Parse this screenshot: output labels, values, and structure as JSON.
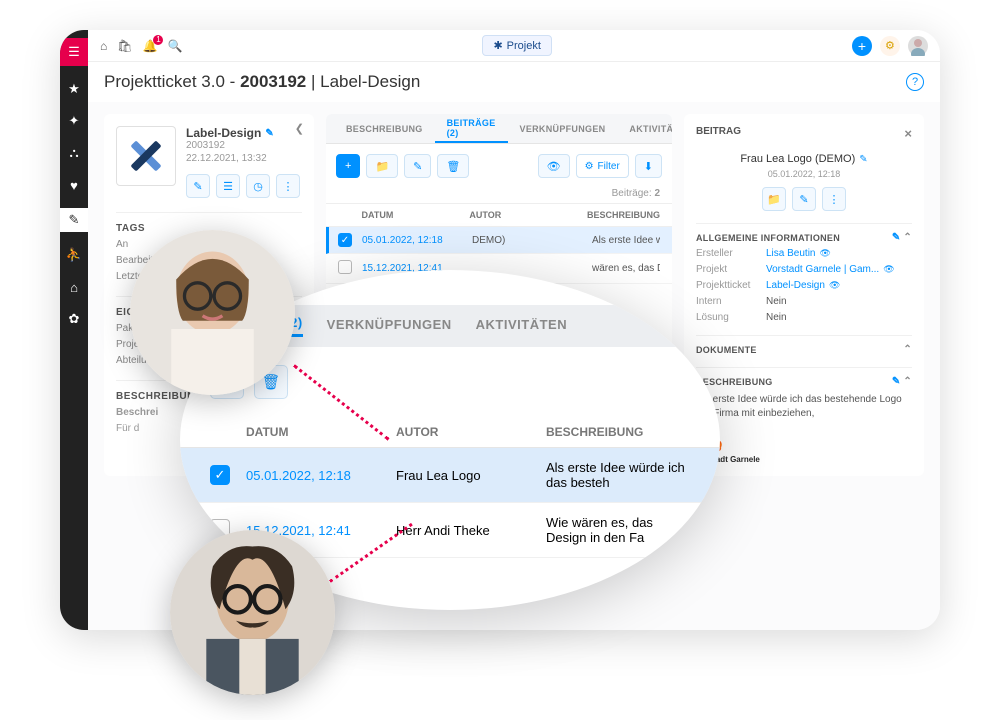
{
  "header": {
    "projectPill": "Projekt",
    "pageTitlePrefix": "Projektticket 3.0 - ",
    "pageTitleId": "2003192",
    "pageTitleName": " | Label-Design",
    "notificationCount": "1",
    "helpLabel": "?"
  },
  "leftPanel": {
    "title": "Label-Design",
    "id": "2003192",
    "date": "22.12.2021, 13:32",
    "sections": {
      "tags": "TAGS",
      "anbearbeitTruncated": "An",
      "bearbeit": "Bearbeit",
      "letzterBenh": "Letzter Benh",
      "eigenschaften": "EIGENSCHAFTEN",
      "paket": "Paket",
      "projektphase": "Projektphase",
      "abteilung": "Abteilung",
      "beschreibung": "BESCHREIBUNG",
      "beschreibTitle": "Beschrei",
      "beschreibBody": "Für d"
    }
  },
  "tabs": {
    "beschreibung": "BESCHREIBUNG",
    "beitraege": "BEITRÄGE (2)",
    "verknuepfungen": "VERKNÜPFUNGEN",
    "aktivitaeten": "AKTIVITÄTEN"
  },
  "midPanel": {
    "filterLabel": "Filter",
    "countLabel": "Beiträge: ",
    "countValue": "2",
    "columns": {
      "datum": "DATUM",
      "autor": "AUTOR",
      "beschreibung": "BESCHREIBUNG"
    },
    "rows": [
      {
        "selected": true,
        "date": "05.01.2022, 12:18",
        "authorTruncated": "DEMO)",
        "desc": "Als erste Idee würde ich das beste"
      },
      {
        "selected": false,
        "date": "15.12.2021, 12:41",
        "authorTruncated": "",
        "desc": "wären es, das Design in den I"
      }
    ]
  },
  "rightPanel": {
    "header": "BEITRAG",
    "title": "Frau Lea Logo (DEMO)",
    "date": "05.01.2022, 12:18",
    "sections": {
      "allgemeine": "ALLGEMEINE INFORMATIONEN",
      "dokumente": "DOKUMENTE",
      "beschreibung": "BESCHREIBUNG"
    },
    "info": {
      "erstellerLbl": "Ersteller",
      "erstellerVal": "Lisa Beutin",
      "projektLbl": "Projekt",
      "projektVal": "Vorstadt Garnele | Gam...",
      "ticketLbl": "Projektticket",
      "ticketVal": "Label-Design",
      "internLbl": "Intern",
      "internVal": "Nein",
      "loesungLbl": "Lösung",
      "loesungVal": "Nein"
    },
    "descText": "Als erste Idee würde ich das bestehende Logo der Firma mit einbeziehen,",
    "logoName": "Vorstadt Garnele"
  },
  "zoom": {
    "tabs": {
      "beitraege": "BEITRÄGE (2)",
      "verknuepfungen": "VERKNÜPFUNGEN",
      "aktivitaeten": "AKTIVITÄTEN"
    },
    "columns": {
      "datum": "DATUM",
      "autor": "AUTOR",
      "beschreibung": "BESCHREIBUNG"
    },
    "rows": [
      {
        "selected": true,
        "date": "05.01.2022, 12:18",
        "author": "Frau Lea Logo",
        "desc": "Als erste Idee würde ich das besteh"
      },
      {
        "selected": false,
        "date": "15.12.2021, 12:41",
        "author": "Herr Andi Theke",
        "desc": "Wie wären es, das Design in den Fa"
      }
    ]
  }
}
